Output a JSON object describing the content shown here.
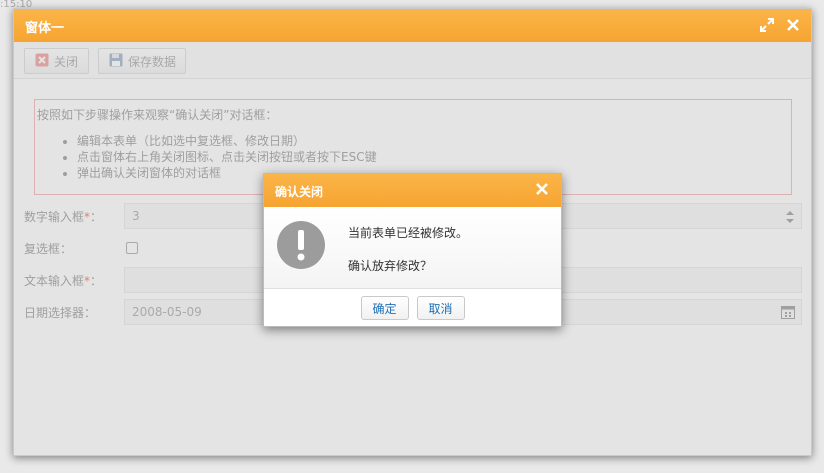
{
  "corner_time": ":15:10",
  "window": {
    "title": "窗体一",
    "toolbar": {
      "close_label": "关闭",
      "save_label": "保存数据"
    }
  },
  "notice": {
    "heading": "按照如下步骤操作来观察“确认关闭”对话框：",
    "steps": [
      "编辑本表单（比如选中复选框、修改日期）",
      "点击窗体右上角关闭图标、点击关闭按钮或者按下ESC键",
      "弹出确认关闭窗体的对话框"
    ]
  },
  "form": {
    "number_label": "数字输入框",
    "number_value": "3",
    "checkbox_label": "复选框：",
    "text_label": "文本输入框",
    "text_value": "",
    "date_label": "日期选择器：",
    "date_value": "2008-05-09",
    "required_mark": "*",
    "colon": "："
  },
  "dialog": {
    "title": "确认关闭",
    "message_line1": "当前表单已经被修改。",
    "message_line2": "确认放弃修改？",
    "ok_label": "确定",
    "cancel_label": "取消"
  },
  "colors": {
    "header_orange": "#f6a431",
    "link_blue": "#1f6fb5"
  }
}
